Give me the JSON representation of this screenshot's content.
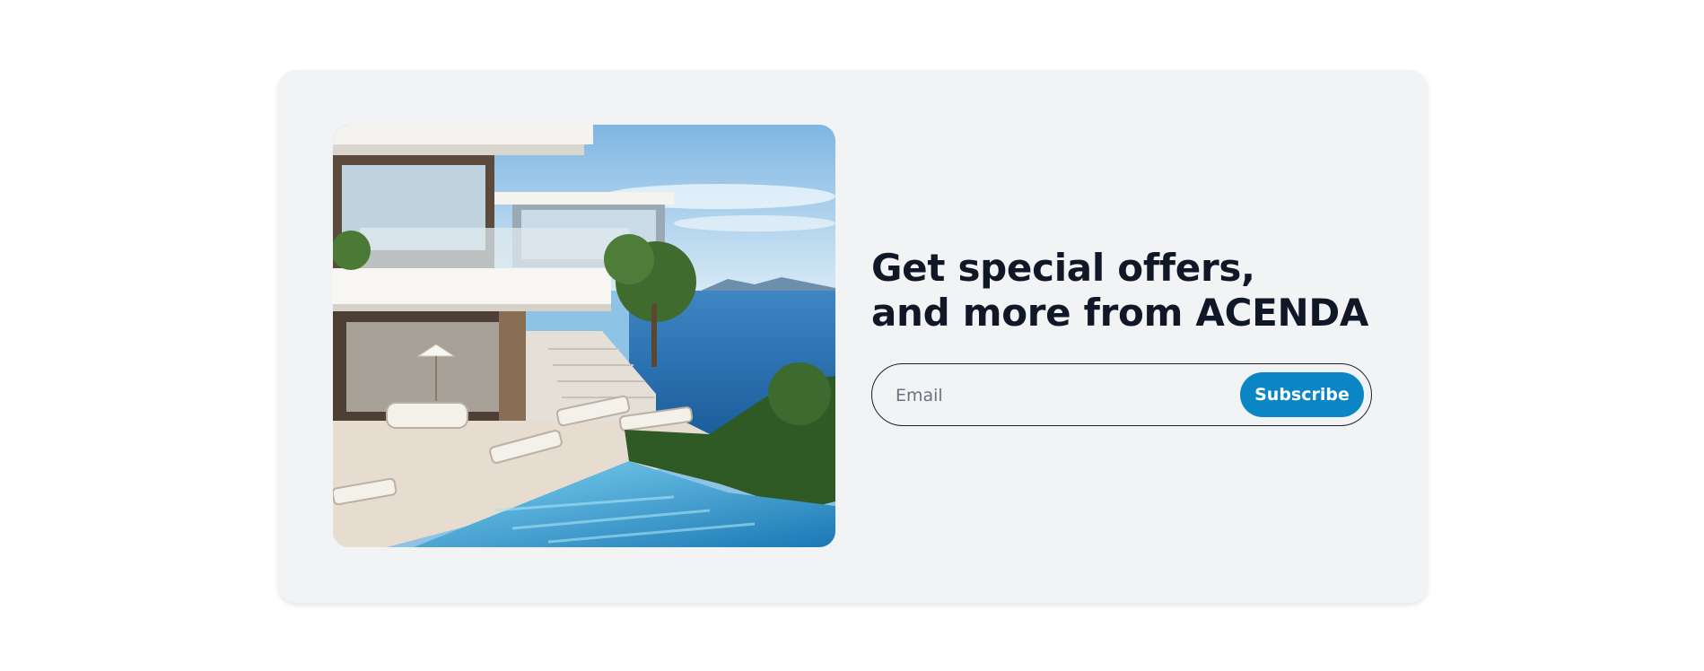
{
  "newsletter": {
    "headline_line1": "Get special offers,",
    "headline_line2": "and more from ACENDA",
    "email_placeholder": "Email",
    "email_value": "",
    "subscribe_label": "Subscribe",
    "image_subject": "luxury villa with infinity pool overlooking the sea"
  },
  "colors": {
    "card_background": "#f2f3f5",
    "headline": "#101828",
    "button_background": "#0b86c5",
    "button_text": "#ffffff",
    "field_border": "#1a1f2e"
  }
}
